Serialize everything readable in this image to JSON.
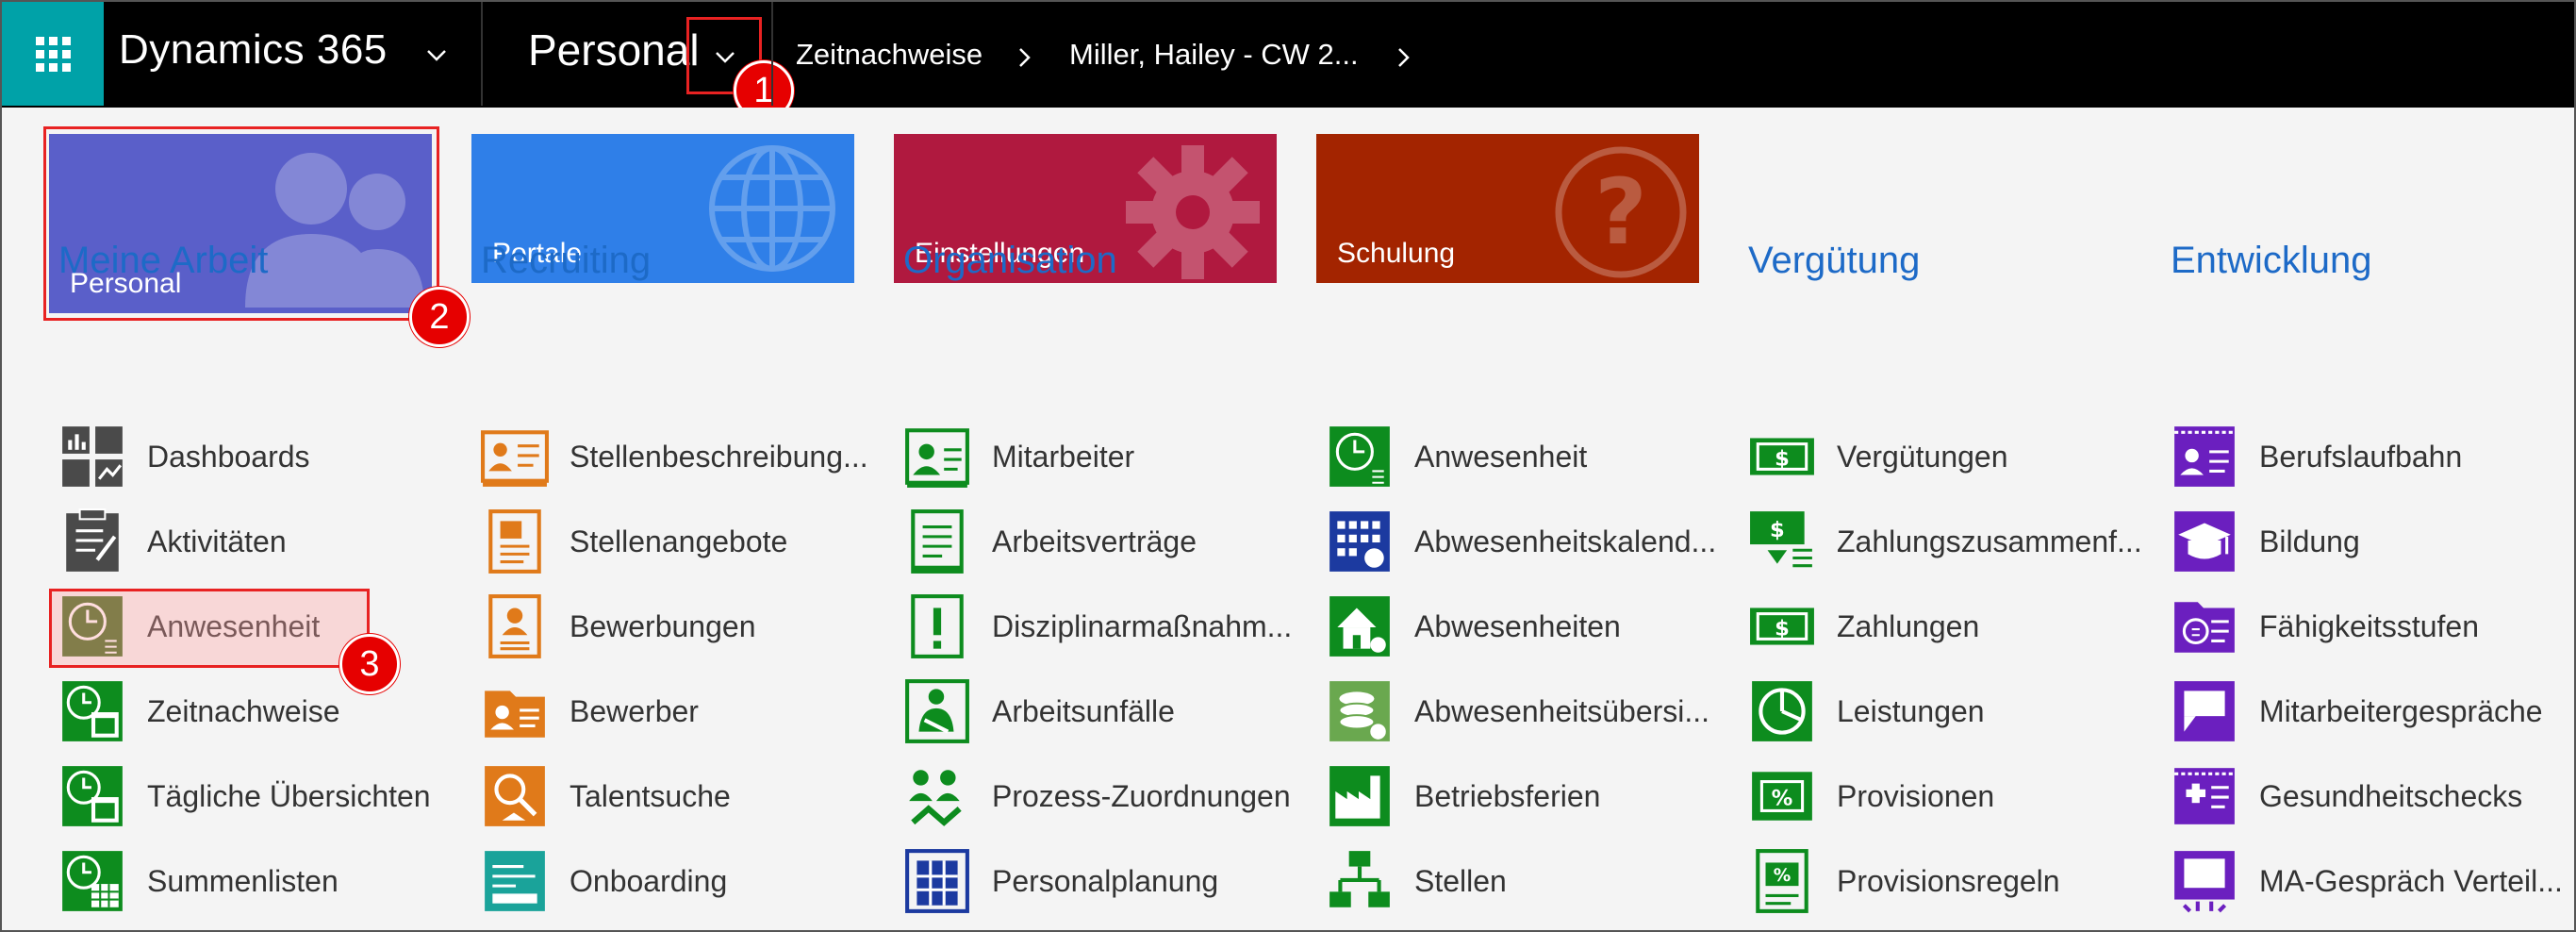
{
  "topbar": {
    "app_title": "Dynamics 365",
    "area_title": "Personal",
    "breadcrumb_1": "Zeitnachweise",
    "breadcrumb_2": "Miller, Hailey - CW 2..."
  },
  "callouts": {
    "one": "1",
    "two": "2",
    "three": "3"
  },
  "tiles": {
    "personal": "Personal",
    "portale": "Portale",
    "einstellungen": "Einstellungen",
    "schulung": "Schulung"
  },
  "groups": {
    "meine_arbeit": {
      "title": "Meine Arbeit",
      "items": [
        "Dashboards",
        "Aktivitäten",
        "Anwesenheit",
        "Zeitnachweise",
        "Tägliche Übersichten",
        "Summenlisten"
      ]
    },
    "recruiting": {
      "title": "Recruiting",
      "items": [
        "Stellenbeschreibung...",
        "Stellenangebote",
        "Bewerbungen",
        "Bewerber",
        "Talentsuche",
        "Onboarding"
      ]
    },
    "organisation": {
      "title": "Organisation",
      "items": [
        "Mitarbeiter",
        "Arbeitsverträge",
        "Disziplinarmaßnahm...",
        "Arbeitsunfälle",
        "Prozess-Zuordnungen",
        "Personalplanung"
      ]
    },
    "organisation2": {
      "items": [
        "Anwesenheit",
        "Abwesenheitskalend...",
        "Abwesenheiten",
        "Abwesenheitsübersi...",
        "Betriebsferien",
        "Stellen"
      ]
    },
    "verguetung": {
      "title": "Vergütung",
      "items": [
        "Vergütungen",
        "Zahlungszusammenf...",
        "Zahlungen",
        "Leistungen",
        "Provisionen",
        "Provisionsregeln"
      ]
    },
    "entwicklung": {
      "title": "Entwicklung",
      "items": [
        "Berufslaufbahn",
        "Bildung",
        "Fähigkeitsstufen",
        "Mitarbeitergespräche",
        "Gesundheitschecks",
        "MA-Gespräch Verteil..."
      ]
    }
  },
  "colors": {
    "accent_teal": "#00a2a8",
    "tile_personal": "#5a5fc9",
    "tile_portale": "#2f7fe8",
    "tile_einstellungen": "#b0193f",
    "tile_schulung": "#a32400",
    "heading_blue": "#1d6ac7",
    "icon_gray": "#4a4a4a",
    "icon_orange": "#e07a1a",
    "icon_green": "#0d8c1e",
    "icon_navy": "#1c3aa0",
    "icon_purple": "#6b1fbf",
    "callout_red": "#e60000"
  },
  "icons": {
    "meine_arbeit": [
      "dashboard-icon",
      "clipboard-icon",
      "clock-icon",
      "calendar-clock-icon",
      "calendar-clock-icon",
      "calendar-grid-icon"
    ],
    "recruiting": [
      "id-card-icon",
      "document-icon",
      "applicant-icon",
      "applicant-folder-icon",
      "search-person-icon",
      "onboarding-icon"
    ],
    "organisation": [
      "employee-card-icon",
      "contract-icon",
      "warning-icon",
      "injury-icon",
      "process-icon",
      "building-icon"
    ],
    "organisation2": [
      "clock-icon",
      "calendar-icon",
      "home-icon",
      "coins-icon",
      "factory-icon",
      "org-chart-icon"
    ],
    "verguetung": [
      "money-icon",
      "money-summary-icon",
      "money-icon",
      "pie-icon",
      "percent-icon",
      "percent-doc-icon"
    ],
    "entwicklung": [
      "career-icon",
      "graduation-icon",
      "skills-icon",
      "conversation-icon",
      "health-icon",
      "review-icon"
    ]
  }
}
